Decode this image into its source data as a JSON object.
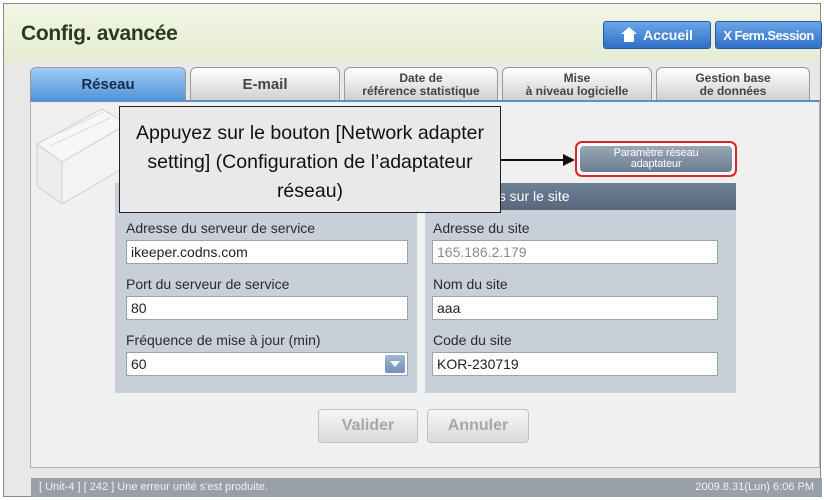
{
  "header": {
    "title": "Config. avancée",
    "home_label": "Accueil",
    "logout_label": "X Ferm.Session"
  },
  "tabs": [
    {
      "label": "Réseau",
      "active": true
    },
    {
      "label": "E-mail",
      "active": false
    },
    {
      "label": "Date de\nréférence statistique",
      "active": false
    },
    {
      "label": "Mise\nà niveau logicielle",
      "active": false
    },
    {
      "label": "Gestion base\nde données",
      "active": false
    }
  ],
  "network_button": {
    "label_line1": "Paramètre réseau",
    "label_line2": "adaptateur"
  },
  "callout": {
    "text": "Appuyez sur le bouton [Network adapter setting] (Configuration de l’adaptateur réseau)"
  },
  "server": {
    "address_label": "Adresse du serveur de service",
    "address_value": "ikeeper.codns.com",
    "port_label": "Port du serveur de service",
    "port_value": "80",
    "freq_label": "Fréquence de mise à jour (min)",
    "freq_value": "60"
  },
  "site": {
    "section_title": "ns sur le site",
    "address_label": "Adresse du site",
    "address_value": "165.186.2.179",
    "name_label": "Nom du site",
    "name_value": "aaa",
    "code_label": "Code du site",
    "code_value": "KOR-230719"
  },
  "actions": {
    "validate_label": "Valider",
    "cancel_label": "Annuler"
  },
  "status": {
    "message": "[ Unit-4 ] [ 242 ] Une erreur unité s'est produite.",
    "datetime": "2009.8.31(Lun)  6:06 PM"
  }
}
